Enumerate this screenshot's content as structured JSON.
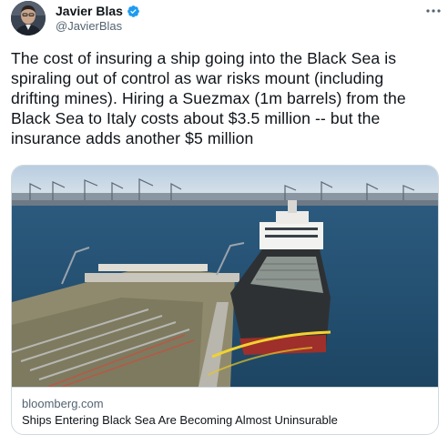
{
  "author": {
    "name": "Javier Blas",
    "handle": "@JavierBlas",
    "verified": true,
    "avatar_icon": "avatar-photo"
  },
  "menu": {
    "icon": "more-horizontal-icon"
  },
  "tweet": {
    "lines": [
      "The cost of insuring a ship going into the Black Sea is",
      "spiraling out of control as war risks mount (including",
      "drifting mines). Hiring a Suezmax (1m barrels) from the",
      "Black Sea to Italy costs about $3.5 million -- but the",
      "insurance adds another $5 million"
    ]
  },
  "card": {
    "domain": "bloomberg.com",
    "title": "Ships Entering Black Sea Are Becoming Almost Uninsurable",
    "image_description_icon": "tanker-port-photo"
  },
  "colors": {
    "text": "#0f1419",
    "secondary": "#536471",
    "verified": "#1d9bf0",
    "border": "#cfd9de"
  }
}
